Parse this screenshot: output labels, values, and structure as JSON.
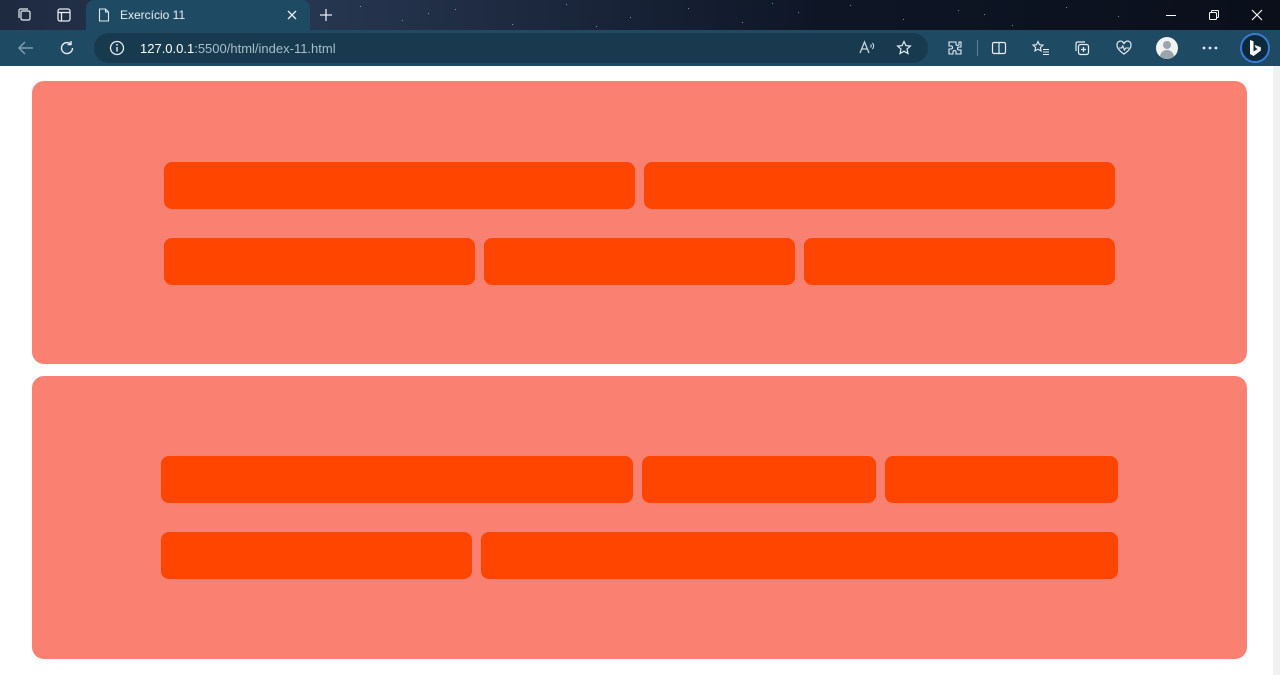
{
  "window": {
    "tab_title": "Exercício 11"
  },
  "address_bar": {
    "url_host": "127.0.0.1",
    "url_rest": ":5500/html/index-11.html"
  },
  "colors": {
    "panel_background": "#fa8072",
    "block_background": "#ff4500",
    "toolbar_background": "#1f4a63"
  },
  "icons": {
    "workspaces": "workspaces-icon",
    "tab_actions": "tab-actions-icon",
    "page": "page-icon",
    "close_tab": "close-icon",
    "new_tab": "plus-icon",
    "minimize": "minimize-icon",
    "restore": "restore-icon",
    "close_window": "close-icon",
    "back": "back-arrow-icon",
    "refresh": "refresh-icon",
    "site_info": "info-icon",
    "read_aloud": "read-aloud-icon",
    "favorite": "star-icon",
    "extensions": "extensions-icon",
    "split_screen": "split-screen-icon",
    "favorites": "favorites-icon",
    "collections": "collections-icon",
    "browser_essentials": "heart-pulse-icon",
    "profile": "profile-icon",
    "more": "more-icon",
    "copilot": "bing-icon"
  },
  "content": {
    "panels": [
      {
        "rows": [
          [
            "block",
            "block"
          ],
          [
            "block",
            "block",
            "block"
          ]
        ]
      },
      {
        "rows": [
          [
            "block",
            "block",
            "block"
          ],
          [
            "block",
            "block"
          ]
        ]
      }
    ]
  }
}
